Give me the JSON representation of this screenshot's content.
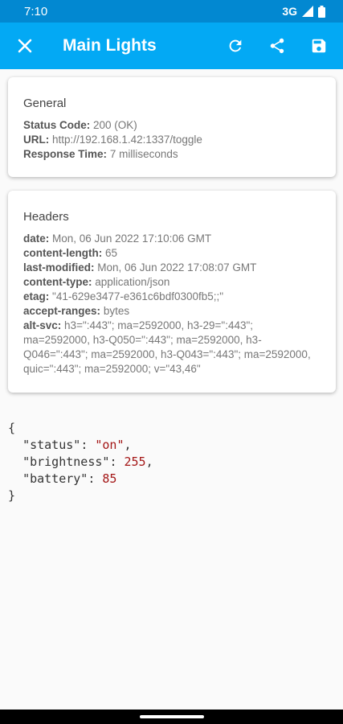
{
  "status_bar": {
    "time": "7:10",
    "network": "3G"
  },
  "app_bar": {
    "title": "Main Lights",
    "icons": [
      "close-icon",
      "refresh-icon",
      "share-icon",
      "save-icon"
    ]
  },
  "general": {
    "title": "General",
    "status_code_label": "Status Code:",
    "status_code_value": "200 (OK)",
    "url_label": "URL:",
    "url_value": "http://192.168.1.42:1337/toggle",
    "response_time_label": "Response Time:",
    "response_time_value": "7 milliseconds"
  },
  "headers": {
    "title": "Headers",
    "items": [
      {
        "name": "date:",
        "value": "Mon, 06 Jun 2022 17:10:06 GMT"
      },
      {
        "name": "content-length:",
        "value": "65"
      },
      {
        "name": "last-modified:",
        "value": "Mon, 06 Jun 2022 17:08:07 GMT"
      },
      {
        "name": "content-type:",
        "value": "application/json"
      },
      {
        "name": "etag:",
        "value": "\"41-629e3477-e361c6bdf0300fb5;;\""
      },
      {
        "name": "accept-ranges:",
        "value": "bytes"
      },
      {
        "name": "alt-svc:",
        "value": "h3=\":443\"; ma=2592000, h3-29=\":443\"; ma=2592000, h3-Q050=\":443\"; ma=2592000, h3-Q046=\":443\"; ma=2592000, h3-Q043=\":443\"; ma=2592000, quic=\":443\"; ma=2592000; v=\"43,46\""
      }
    ]
  },
  "response_body": {
    "open_brace": "{",
    "close_brace": "}",
    "status_key": "\"status\"",
    "status_value": "\"on\"",
    "brightness_key": "\"brightness\"",
    "brightness_value": "255",
    "battery_key": "\"battery\"",
    "battery_value": "85"
  },
  "colors": {
    "status_bar": "#0288d1",
    "app_bar": "#03a9f4",
    "json_value": "#a31515"
  }
}
